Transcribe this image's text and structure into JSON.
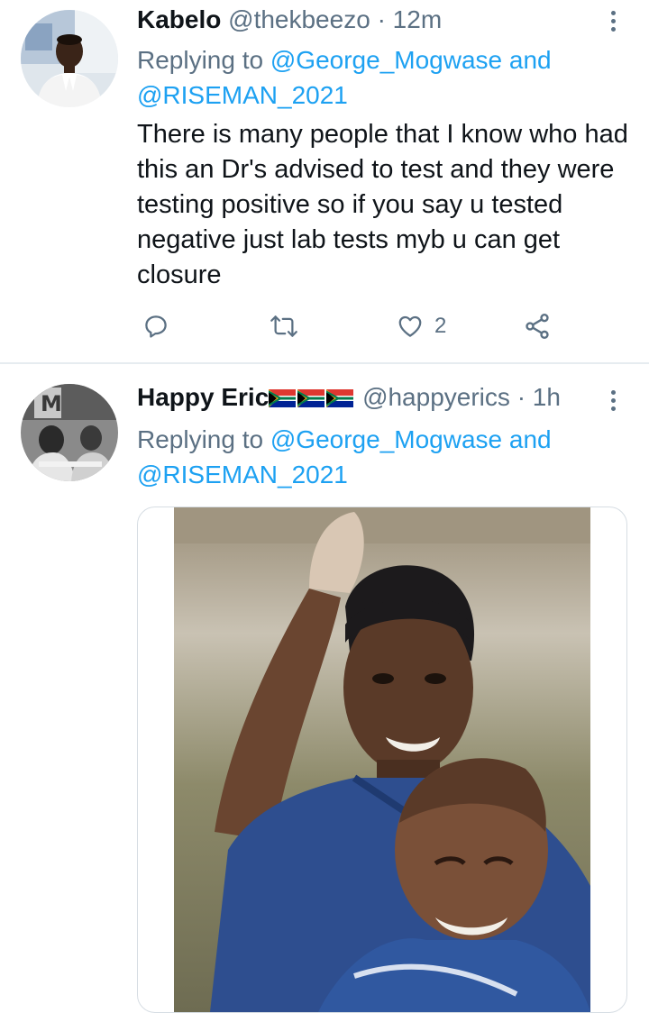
{
  "tweets": [
    {
      "name": "Kabelo",
      "handle": "@thekbeezo",
      "separator": "·",
      "time": "12m",
      "replying_prefix": "Replying to",
      "mention1": "@George_Mogwase",
      "and_word": "and",
      "mention2": "@RISEMAN_2021",
      "text": "There is many people that I know who had this an Dr's advised to test and they were testing positive so if you say u tested negative just lab tests myb u can get closure",
      "like_count": "2",
      "icons": {
        "reply": "reply-icon",
        "retweet": "retweet-icon",
        "like": "heart-icon",
        "share": "share-icon",
        "more": "more-vertical-icon"
      }
    },
    {
      "name": "Happy Eric",
      "name_emoji": [
        "flag-south-africa",
        "flag-south-africa",
        "flag-south-africa"
      ],
      "handle": "@happyerics",
      "separator": "·",
      "time": "1h",
      "replying_prefix": "Replying to",
      "mention1": "@George_Mogwase",
      "and_word": "and",
      "mention2": "@RISEMAN_2021",
      "media": "photo",
      "icons": {
        "more": "more-vertical-icon"
      }
    }
  ],
  "colors": {
    "link": "#1da1f2",
    "secondary_text": "#5b7083",
    "primary_text": "#0f1419",
    "divider": "#e6ecf0"
  }
}
